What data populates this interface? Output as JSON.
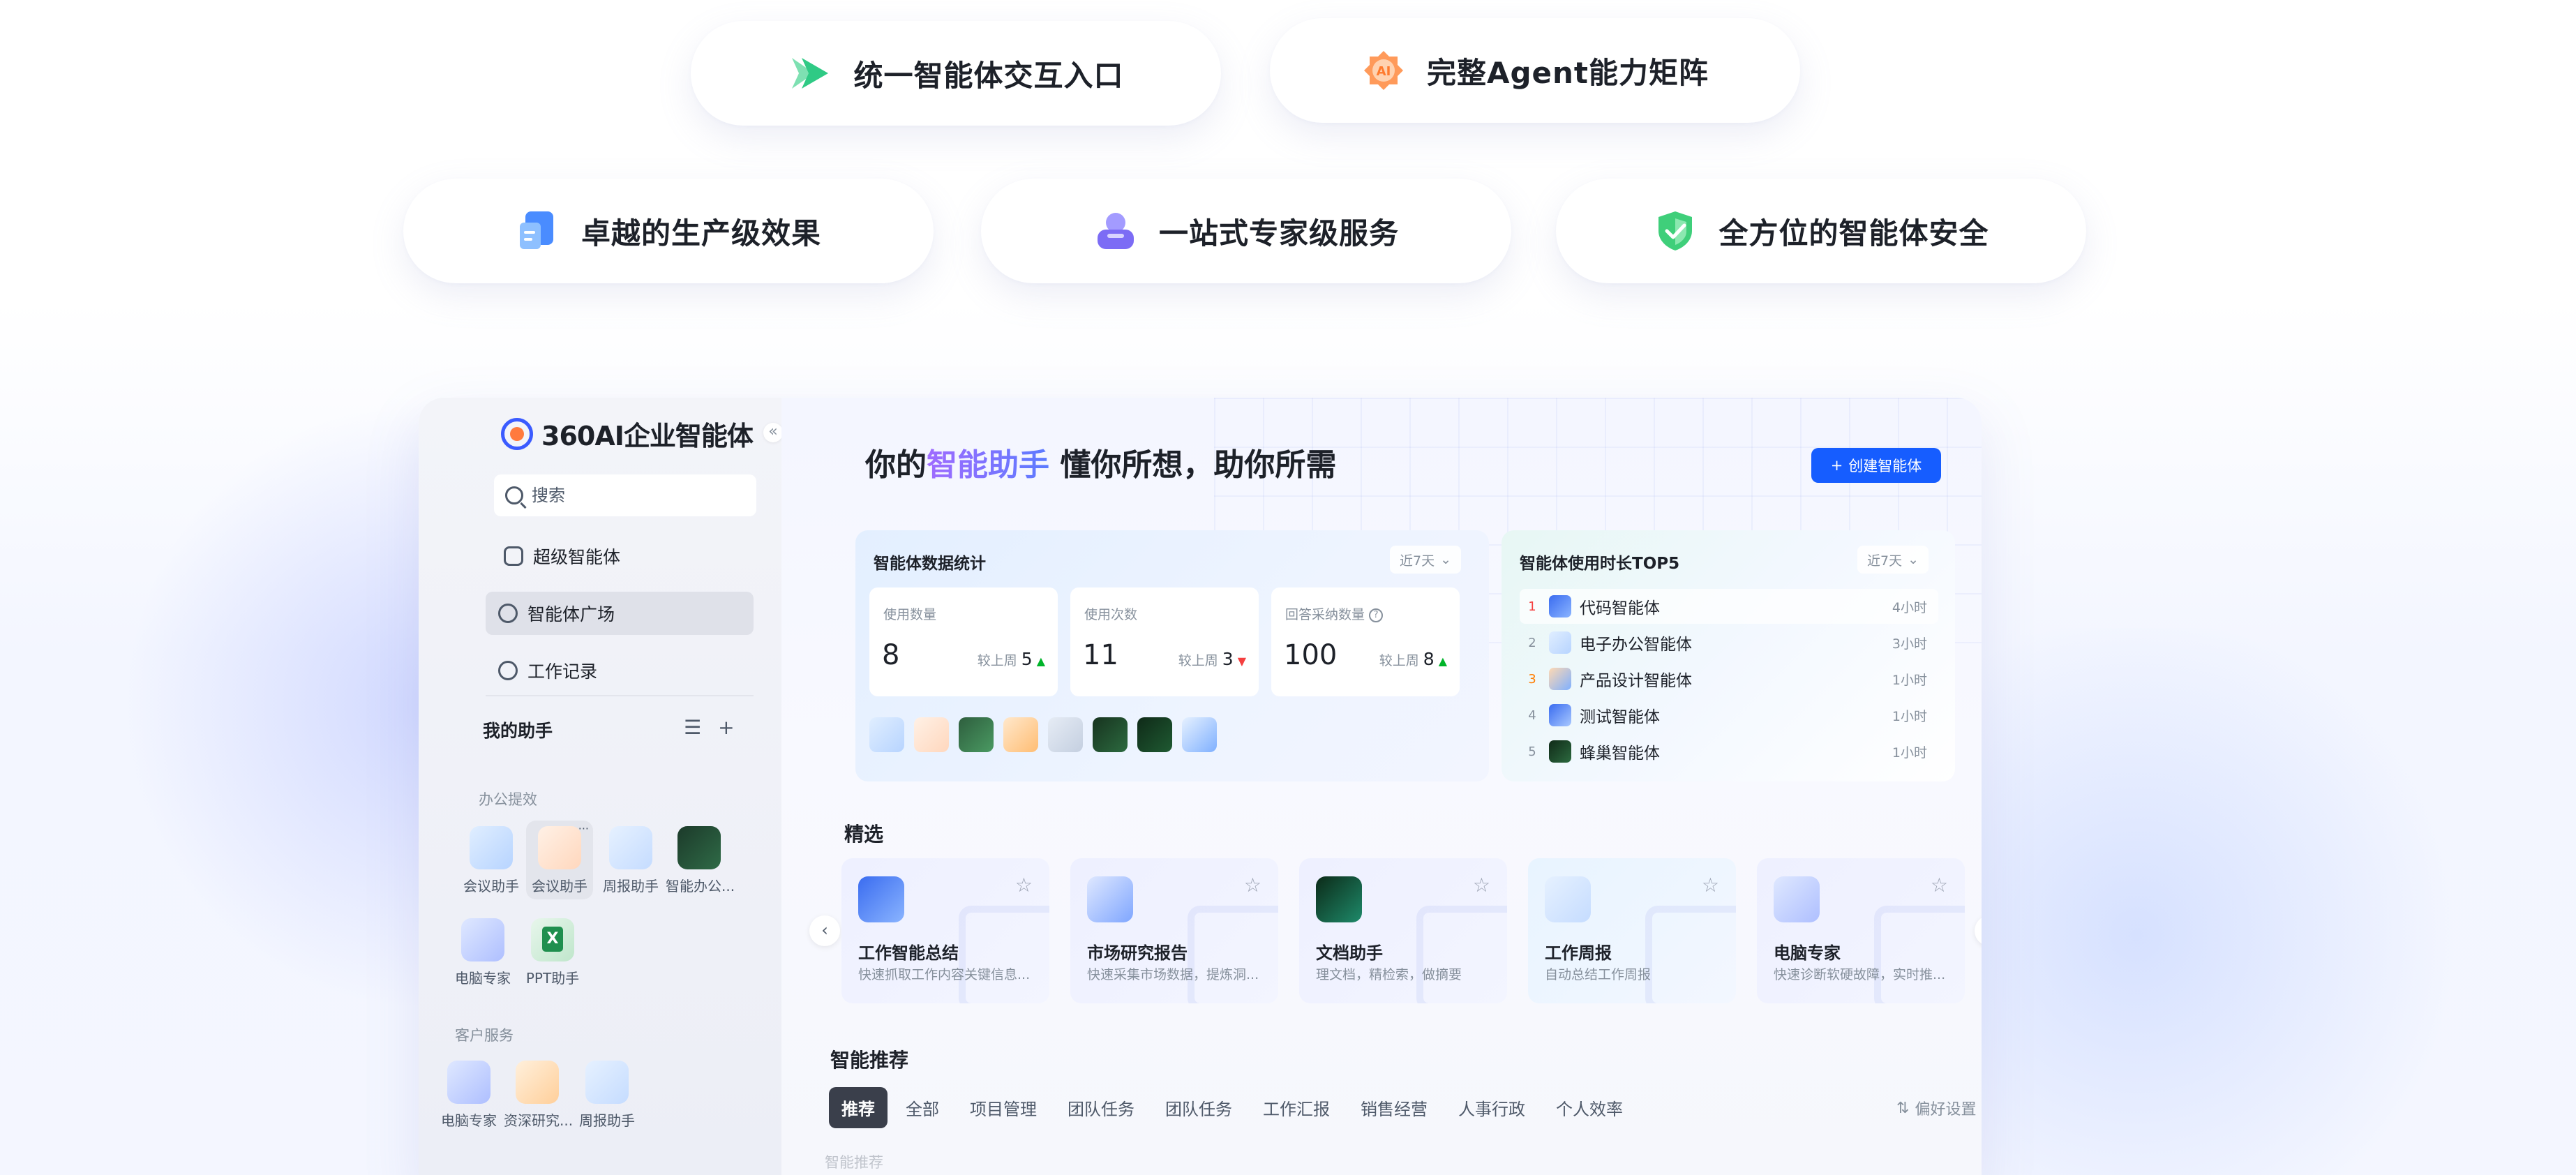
{
  "features": [
    {
      "label": "统一智能体交互入口",
      "icon": "play-arrow-icon",
      "color": "#3ccf8e"
    },
    {
      "label": "完整Agent能力矩阵",
      "icon": "ai-badge-icon",
      "color": "#ff8a3d"
    },
    {
      "label": "卓越的生产级效果",
      "icon": "document-cube-icon",
      "color": "#3b82f6"
    },
    {
      "label": "一站式专家级服务",
      "icon": "expert-person-icon",
      "color": "#8b7cf6"
    },
    {
      "label": "全方位的智能体安全",
      "icon": "shield-check-icon",
      "color": "#22c55e"
    }
  ],
  "sidebar": {
    "brand": "360AI企业智能体",
    "collapse": "«",
    "search_placeholder": "搜索",
    "nav": [
      {
        "label": "超级智能体",
        "icon": "robot-icon"
      },
      {
        "label": "智能体广场",
        "icon": "plaza-icon",
        "active": true
      },
      {
        "label": "工作记录",
        "icon": "history-icon"
      }
    ],
    "my_title": "我的助手",
    "tools": [
      "☰",
      "+"
    ],
    "groups": [
      {
        "label": "办公提效",
        "items": [
          "会议助手",
          "会议助手",
          "周报助手",
          "智能办公...",
          "电脑专家",
          "PPT助手"
        ]
      },
      {
        "label": "客户服务",
        "items": [
          "电脑专家",
          "资深研究...",
          "周报助手"
        ]
      }
    ],
    "more": "···"
  },
  "main": {
    "title_pre": "你的",
    "title_hl": "智能助手",
    "title_post": " 懂你所想，助你所需",
    "create_label": "创建智能体",
    "stats": {
      "title": "智能体数据统计",
      "range": "近7天",
      "items": [
        {
          "label": "使用数量",
          "value": "8",
          "cmp": "较上周",
          "delta": "5",
          "dir": "up"
        },
        {
          "label": "使用次数",
          "value": "11",
          "cmp": "较上周",
          "delta": "3",
          "dir": "down"
        },
        {
          "label": "回答采纳数量",
          "value": "100",
          "cmp": "较上周",
          "delta": "8",
          "dir": "up"
        }
      ]
    },
    "top5": {
      "title": "智能体使用时长TOP5",
      "range": "近7天",
      "rows": [
        {
          "rank": "1",
          "name": "代码智能体",
          "time": "4小时"
        },
        {
          "rank": "2",
          "name": "电子办公智能体",
          "time": "3小时"
        },
        {
          "rank": "3",
          "name": "产品设计智能体",
          "time": "1小时"
        },
        {
          "rank": "4",
          "name": "测试智能体",
          "time": "1小时"
        },
        {
          "rank": "5",
          "name": "蜂巢智能体",
          "time": "1小时"
        }
      ]
    },
    "featured_title": "精选",
    "featured": [
      {
        "name": "工作智能总结",
        "desc": "快速抓取工作内容关键信息..."
      },
      {
        "name": "市场研究报告",
        "desc": "快速采集市场数据，提炼洞..."
      },
      {
        "name": "文档助手",
        "desc": "理文档，精检索，做摘要"
      },
      {
        "name": "工作周报",
        "desc": "自动总结工作周报"
      },
      {
        "name": "电脑专家",
        "desc": "快速诊断软硬故障，实时推..."
      }
    ],
    "rec_title": "智能推荐",
    "tabs": [
      "推荐",
      "全部",
      "项目管理",
      "团队任务",
      "团队任务",
      "工作汇报",
      "销售经营",
      "人事行政",
      "个人效率"
    ],
    "pref_label": "偏好设置",
    "sub_rec": "智能推荐"
  }
}
